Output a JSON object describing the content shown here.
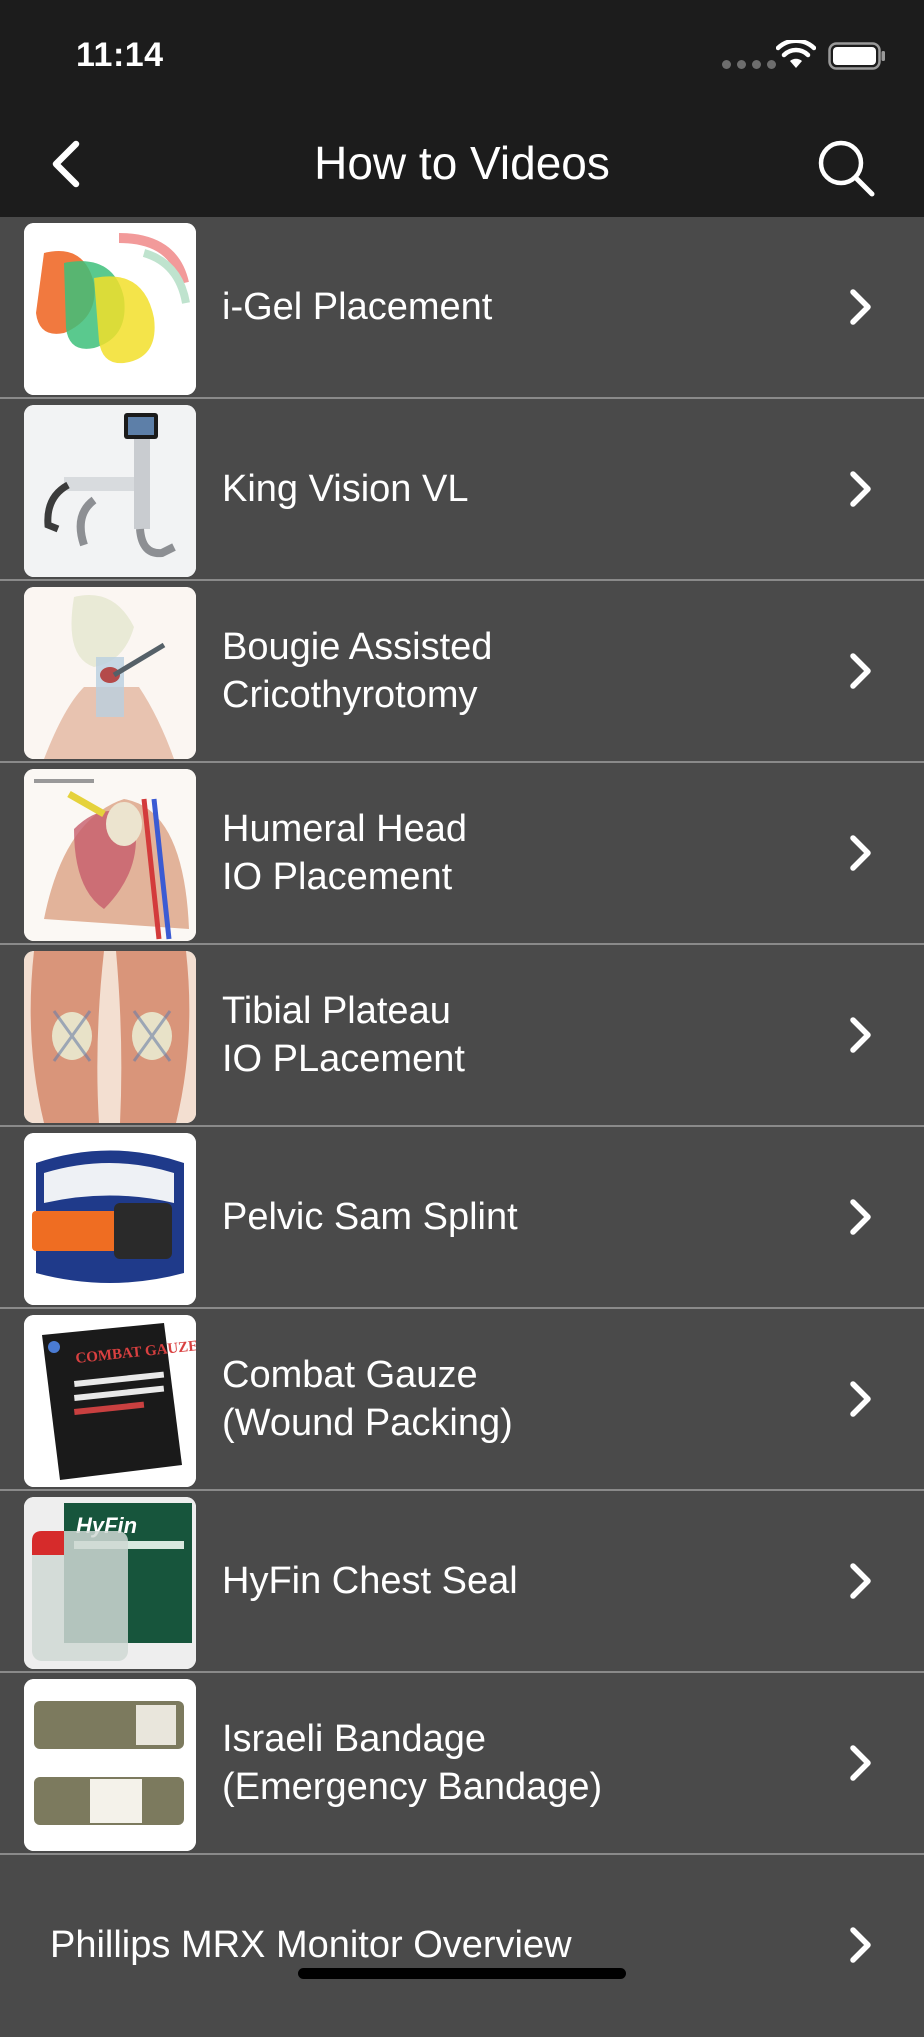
{
  "status_bar": {
    "time": "11:14"
  },
  "nav": {
    "title": "How to Videos"
  },
  "items": [
    {
      "label": "i-Gel Placement",
      "thumb": "igel-thumbnail"
    },
    {
      "label": "King Vision VL",
      "thumb": "king-vision-thumbnail"
    },
    {
      "label": "Bougie Assisted\nCricothyrotomy",
      "thumb": "cricothyrotomy-thumbnail"
    },
    {
      "label": "Humeral Head\nIO Placement",
      "thumb": "humeral-head-thumbnail"
    },
    {
      "label": "Tibial Plateau\nIO PLacement",
      "thumb": "tibial-plateau-thumbnail"
    },
    {
      "label": "Pelvic Sam Splint",
      "thumb": "pelvic-splint-thumbnail"
    },
    {
      "label": "Combat Gauze\n(Wound Packing)",
      "thumb": "combat-gauze-thumbnail"
    },
    {
      "label": "HyFin Chest Seal",
      "thumb": "hyfin-chest-seal-thumbnail"
    },
    {
      "label": "Israeli Bandage\n(Emergency Bandage)",
      "thumb": "israeli-bandage-thumbnail"
    },
    {
      "label": "Phillips MRX Monitor Overview"
    }
  ],
  "thumb_text": {
    "combat_gauze": "COMBAT GAUZE",
    "hyfin": "HyFin"
  },
  "colors": {
    "bar_background": "#1c1c1c",
    "list_background": "#4a4a4a",
    "separator": "#8a8a8a",
    "text": "#ffffff"
  }
}
